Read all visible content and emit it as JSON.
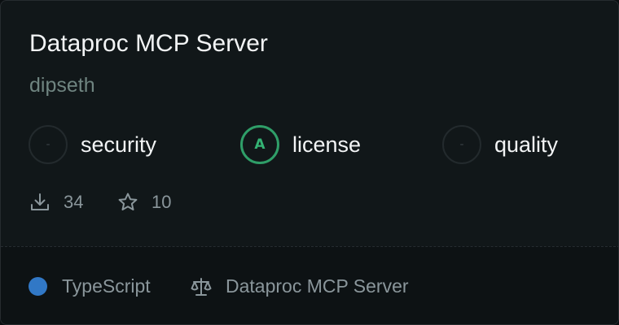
{
  "card": {
    "title": "Dataproc MCP Server",
    "author": "dipseth",
    "scores": [
      {
        "symbol": "-",
        "label": "security",
        "graded": false
      },
      {
        "symbol": "A",
        "label": "license",
        "graded": true
      },
      {
        "symbol": "-",
        "label": "quality",
        "graded": false
      }
    ],
    "stats": {
      "downloads": "34",
      "stars": "10",
      "download_icon": "download-icon",
      "star_icon": "star-icon"
    },
    "footer": {
      "language": "TypeScript",
      "language_color": "#3178c6",
      "license_icon": "scale-icon",
      "license_name": "Dataproc MCP Server"
    },
    "colors": {
      "background": "#111719",
      "grade_accent": "#2f9e68"
    }
  }
}
